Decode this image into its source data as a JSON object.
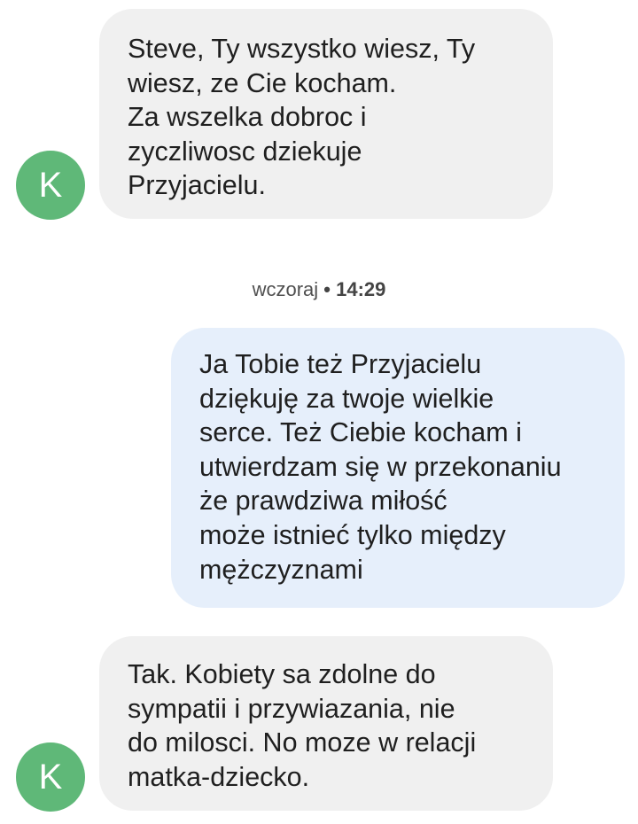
{
  "conversation": {
    "contact_initial": "K",
    "messages": [
      {
        "direction": "incoming",
        "lines": [
          "Steve, Ty wszystko wiesz, Ty",
          "wiesz, ze Cie kocham.",
          "Za wszelka dobroc i",
          "zyczliwosc dziekuje",
          "Przyjacielu."
        ]
      },
      {
        "direction": "outgoing",
        "lines": [
          "Ja Tobie też Przyjacielu",
          "dziękuję za twoje wielkie",
          "serce. Też Ciebie kocham i",
          "utwierdzam się w przekonaniu",
          "że prawdziwa miłość",
          "może istnieć tylko między",
          "mężczyznami"
        ]
      },
      {
        "direction": "incoming",
        "lines": [
          "Tak. Kobiety sa zdolne do",
          "sympatii i przywiazania, nie",
          "do milosci. No moze w relacji",
          "matka-dziecko."
        ]
      }
    ],
    "timestamp": {
      "day": "wczoraj",
      "separator": "•",
      "time": "14:29"
    }
  },
  "colors": {
    "incoming_bubble": "#f0f0f0",
    "outgoing_bubble": "#e6effb",
    "avatar": "#5fb878",
    "text": "#1f1f1f"
  }
}
